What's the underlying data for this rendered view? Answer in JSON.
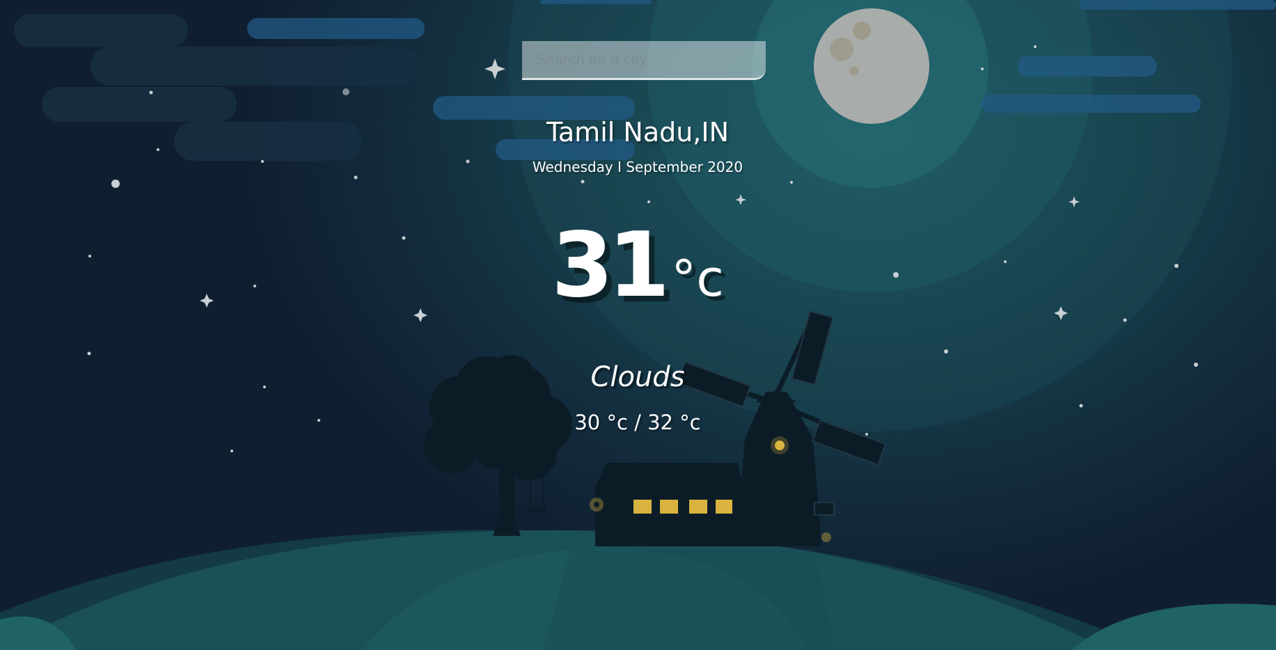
{
  "search": {
    "placeholder": "Search for a city...",
    "value": ""
  },
  "weather": {
    "location": "Tamil Nadu,IN",
    "date": "Wednesday I September 2020",
    "temperature": "31",
    "unit": "°c",
    "condition": "Clouds",
    "hi_lo": "30 °c / 32 °c"
  },
  "theme": {
    "background": "#132c3d",
    "accent": "#1f5563",
    "text": "#ffffff",
    "window_light": "#d9b33f"
  },
  "icons": [
    "moon-icon",
    "cloud-icon",
    "star-icon",
    "windmill-illustration",
    "tree-illustration",
    "house-illustration"
  ]
}
